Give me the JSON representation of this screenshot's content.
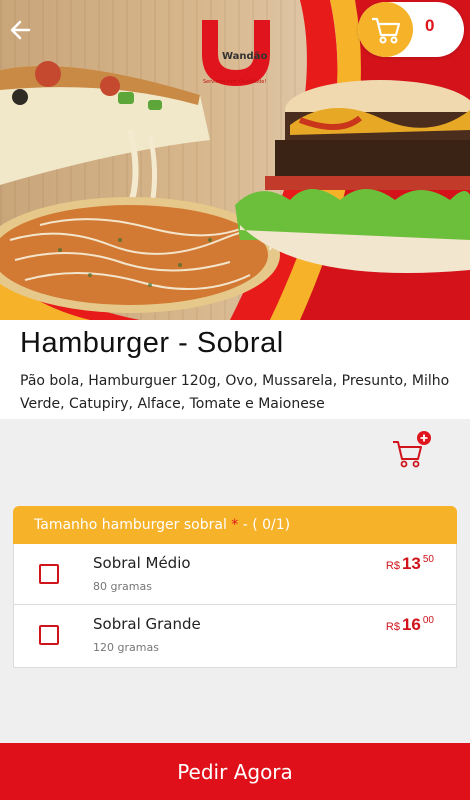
{
  "header": {
    "back_icon": "arrow-left-icon",
    "logo": {
      "name": "Wandão",
      "tagline": "Servindo com Qualidade!"
    },
    "cart": {
      "icon": "cart-icon",
      "count": "0"
    }
  },
  "product": {
    "title": "Hamburger - Sobral",
    "description": "Pão bola, Hamburguer 120g, Ovo, Mussarela, Presunto, Milho Verde, Catupiry, Alface, Tomate e Maionese",
    "add_to_cart_icon": "cart-plus-icon"
  },
  "options_group": {
    "title": "Tamanho hamburger sobral",
    "required_mark": "*",
    "count_text": "- ( 0/1)",
    "items": [
      {
        "name": "Sobral Médio",
        "detail": "80 gramas",
        "currency": "R$",
        "price_int": "13",
        "price_dec": "50",
        "checked": false
      },
      {
        "name": "Sobral Grande",
        "detail": "120 gramas",
        "currency": "R$",
        "price_int": "16",
        "price_dec": "00",
        "checked": false
      }
    ]
  },
  "cta": {
    "label": "Pedir Agora"
  },
  "colors": {
    "accent_red": "#e0101a",
    "accent_yellow": "#f6b229",
    "background": "#efefef"
  }
}
